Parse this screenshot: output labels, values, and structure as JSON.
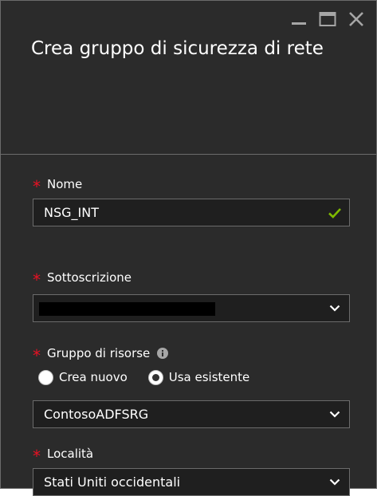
{
  "window": {
    "title": "Crea gruppo di sicurezza di rete",
    "controls": {
      "minimize_icon": "minimize-icon",
      "maximize_icon": "maximize-icon",
      "close_icon": "close-icon"
    }
  },
  "form": {
    "name": {
      "label": "Nome",
      "value": "NSG_INT",
      "valid_icon": "checkmark-icon"
    },
    "subscription": {
      "label": "Sottoscrizione",
      "value": "",
      "redacted": true,
      "dropdown_icon": "chevron-down-icon"
    },
    "resource_group": {
      "label": "Gruppo di risorse",
      "info_icon": "info-icon",
      "options": [
        {
          "label": "Crea nuovo",
          "selected": false
        },
        {
          "label": "Usa esistente",
          "selected": true
        }
      ],
      "value": "ContosoADFSRG",
      "dropdown_icon": "chevron-down-icon"
    },
    "location": {
      "label": "Località",
      "value": "Stati Uniti occidentali",
      "dropdown_icon": "chevron-down-icon"
    },
    "required_marker": "*"
  },
  "colors": {
    "background": "#2b2b2b",
    "border": "#6b6b6b",
    "field_background": "#1f1f1f",
    "text": "#ffffff",
    "required": "#e81123",
    "valid": "#7fba00"
  }
}
